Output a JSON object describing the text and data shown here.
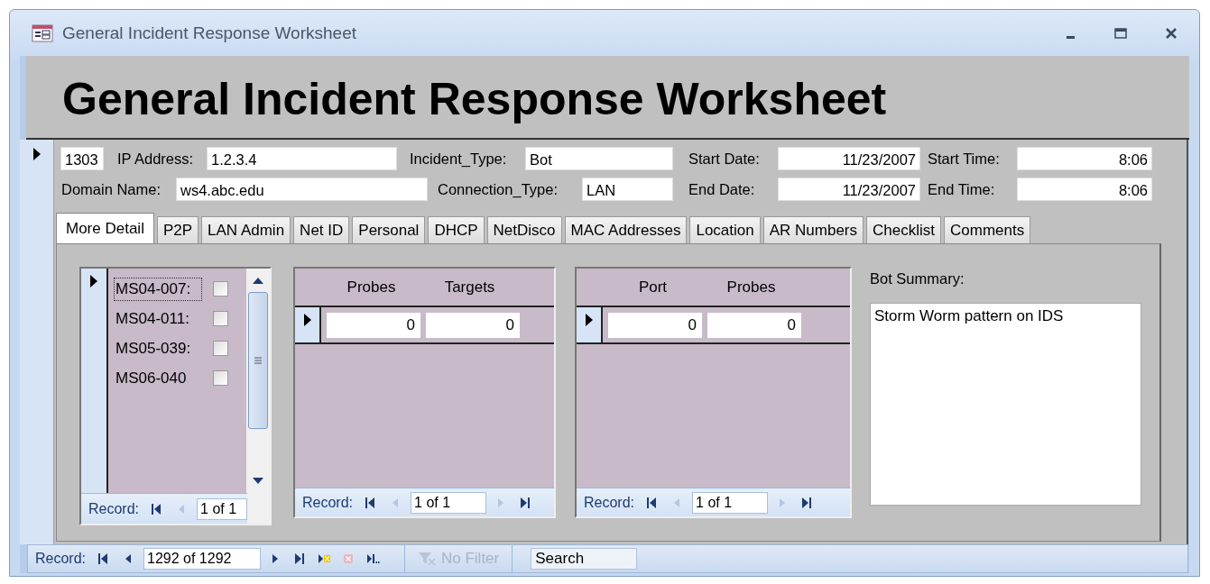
{
  "window": {
    "title": "General Incident Response Worksheet"
  },
  "header": {
    "title": "General Incident Response Worksheet"
  },
  "field_rows": [
    {
      "fields": [
        {
          "kind": "id",
          "value": "1303"
        },
        {
          "kind": "text",
          "label": "IP Address:",
          "value": "1.2.3.4"
        },
        {
          "kind": "text",
          "label": "Incident_Type:",
          "value": "Bot"
        },
        {
          "kind": "date",
          "label": "Start Date:",
          "value": "11/23/2007"
        },
        {
          "kind": "time",
          "label": "Start Time:",
          "value": "8:06"
        }
      ]
    },
    {
      "fields": [
        {
          "kind": "text",
          "label": "Domain Name:",
          "value": "ws4.abc.edu"
        },
        {
          "kind": "text",
          "label": "Connection_Type:",
          "value": "LAN"
        },
        {
          "kind": "date",
          "label": "End Date:",
          "value": "11/23/2007"
        },
        {
          "kind": "time",
          "label": "End Time:",
          "value": "8:06"
        }
      ]
    }
  ],
  "tabs": [
    {
      "label": "More Detail",
      "selected": true
    },
    {
      "label": "P2P",
      "selected": false
    },
    {
      "label": "LAN Admin",
      "selected": false
    },
    {
      "label": "Net ID",
      "selected": false
    },
    {
      "label": "Personal",
      "selected": false
    },
    {
      "label": "DHCP",
      "selected": false
    },
    {
      "label": "NetDisco",
      "selected": false
    },
    {
      "label": "MAC Addresses",
      "selected": false
    },
    {
      "label": "Location",
      "selected": false
    },
    {
      "label": "AR Numbers",
      "selected": false
    },
    {
      "label": "Checklist",
      "selected": false
    },
    {
      "label": "Comments",
      "selected": false
    }
  ],
  "detail": {
    "checklist": {
      "items": [
        {
          "label": "MS04-007:",
          "checked": false,
          "focused": true
        },
        {
          "label": "MS04-011:",
          "checked": false,
          "focused": false
        },
        {
          "label": "MS05-039:",
          "checked": false,
          "focused": false
        },
        {
          "label": "MS06-040",
          "checked": false,
          "focused": false
        }
      ],
      "navigator": {
        "label": "Record:",
        "position": "1 of 1",
        "buttons": [
          {
            "kind": "first",
            "disabled": false
          },
          {
            "kind": "prev",
            "disabled": true
          }
        ]
      }
    },
    "grids": [
      {
        "columns": [
          "Probes",
          "Targets"
        ],
        "rows": [
          [
            "0",
            "0"
          ]
        ],
        "navigator": {
          "label": "Record:",
          "position": "1 of 1",
          "buttons": [
            {
              "kind": "first",
              "disabled": false
            },
            {
              "kind": "prev",
              "disabled": true
            },
            {
              "kind": "next",
              "disabled": true
            },
            {
              "kind": "last",
              "disabled": false
            }
          ]
        }
      },
      {
        "columns": [
          "Port",
          "Probes"
        ],
        "rows": [
          [
            "0",
            "0"
          ]
        ],
        "navigator": {
          "label": "Record:",
          "position": "1 of 1",
          "buttons": [
            {
              "kind": "first",
              "disabled": false
            },
            {
              "kind": "prev",
              "disabled": true
            },
            {
              "kind": "next",
              "disabled": true
            },
            {
              "kind": "last",
              "disabled": false
            }
          ]
        }
      }
    ],
    "summary": {
      "label": "Bot Summary:",
      "value": "Storm Worm pattern on IDS"
    }
  },
  "navigator": {
    "label": "Record:",
    "position": "1292 of 1292",
    "buttons": [
      {
        "kind": "first",
        "disabled": false
      },
      {
        "kind": "prev",
        "disabled": false
      },
      {
        "kind": "next",
        "disabled": false
      },
      {
        "kind": "last",
        "disabled": false
      },
      {
        "kind": "new",
        "disabled": false
      },
      {
        "kind": "delete",
        "disabled": true
      },
      {
        "kind": "more",
        "disabled": false
      }
    ]
  },
  "filter": {
    "label": "No Filter",
    "disabled": true
  },
  "search": {
    "placeholder": "Search"
  }
}
